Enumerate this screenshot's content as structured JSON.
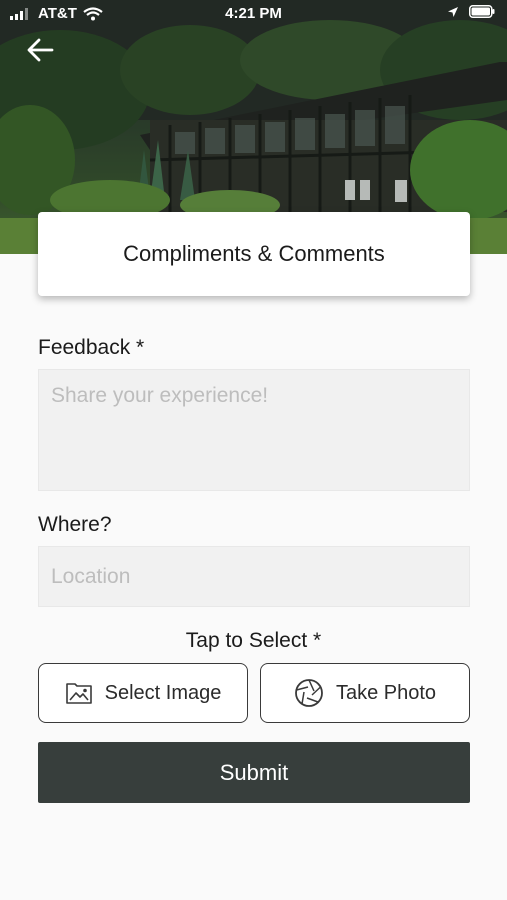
{
  "status_bar": {
    "carrier": "AT&T",
    "time": "4:21 PM",
    "icons": [
      "signal-icon",
      "wifi-icon",
      "location-arrow-icon",
      "battery-icon"
    ]
  },
  "header": {
    "back_icon": "back-arrow-icon",
    "title": "Compliments & Comments"
  },
  "form": {
    "feedback": {
      "label": "Feedback *",
      "placeholder": "Share your experience!",
      "value": ""
    },
    "location": {
      "label": "Where?",
      "placeholder": "Location",
      "value": ""
    },
    "media": {
      "label": "Tap to Select *",
      "select_image_label": "Select Image",
      "select_image_icon": "image-icon",
      "take_photo_label": "Take Photo",
      "take_photo_icon": "camera-aperture-icon"
    },
    "submit_label": "Submit"
  },
  "colors": {
    "background": "#fafafa",
    "field_background": "#f1f1f1",
    "submit_background": "#373e3c",
    "button_border": "#3a3a3a"
  }
}
